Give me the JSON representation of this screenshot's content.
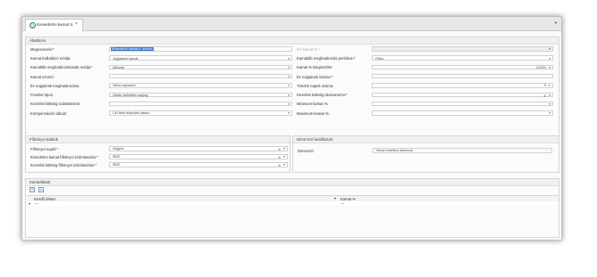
{
  "tab": {
    "title": "Kiesedelmi kamat tr.",
    "close": "×",
    "menu": "▾",
    "icon": "leaf-icon"
  },
  "general": {
    "title": "Általános",
    "left": [
      {
        "label": "Megnevezés:*",
        "value": "Késedelmi kamat tr. szerint",
        "highlight": true
      },
      {
        "label": "Kamat kalkuláció módja:",
        "value": "Jegybanki kamat",
        "ctrl": "dd"
      },
      {
        "label": "Kamatláb meghatározásának módja:*",
        "value": "Időszak",
        "ctrl": "dd"
      },
      {
        "label": "Kamat szorzó:",
        "value": "",
        "ctrl": "dd"
      },
      {
        "label": "Év napjainak meghatározása:",
        "value": "Valós napszám",
        "ctrl": "dd"
      },
      {
        "label": "Fizetési típus:",
        "value": "Utolsó befizetés napjág",
        "ctrl": "dd"
      },
      {
        "label": "Kezelési költség számlakörön:",
        "value": "",
        "ctrl": "dd"
      },
      {
        "label": "Kompenzációs dátum:",
        "value": "Cél tétel teljesítés dátum",
        "ctrl": "dd"
      }
    ],
    "right": [
      {
        "label": "Fix kamat %:*",
        "value": "",
        "ctrl": "dd",
        "disabled": true
      },
      {
        "label": "Kamatláb meghatározás periódus:*",
        "value": "Félév",
        "ctrl": "dd"
      },
      {
        "label": "Kamat % kiegészítés:",
        "value": "5,00%",
        "ctrl": "dd",
        "right": true
      },
      {
        "label": "Év napjainak száma:*",
        "value": "",
        "ctrl": "none"
      },
      {
        "label": "Türelmi napok száma:",
        "value": "5",
        "ctrl": "spin",
        "right": true
      },
      {
        "label": "Kezelési költség devizanemo:*",
        "value": "",
        "ctrl": "clear-dd"
      },
      {
        "label": "Minimum kamat %:",
        "value": "",
        "ctrl": "dd"
      },
      {
        "label": "Maximum kamat %:",
        "value": "",
        "ctrl": "dd"
      }
    ]
  },
  "ledger": {
    "title": "Főkönyvi adatok",
    "rows": [
      {
        "label": "Főkönyvi napló:*",
        "value": "Vegyes",
        "ctrl": "clear-dd"
      },
      {
        "label": "Késedelmi kamat főkönyvi számlaszám:*",
        "value": "9632",
        "ctrl": "clear-dd"
      },
      {
        "label": "Kezelési költség főkönyvi számlaszám:*",
        "value": "9632",
        "ctrl": "clear-dd"
      }
    ]
  },
  "dimension": {
    "title": "Dimenzió beállítások",
    "label": "Dimenzió:",
    "value": "Nincs beállítva dimenzió",
    "button": "···"
  },
  "rates": {
    "title": "Kamatlábak",
    "toolbar": [
      {
        "name": "add-row-icon",
        "glyph": "+"
      },
      {
        "name": "delete-row-icon",
        "glyph": "▪"
      }
    ],
    "columns": [
      "Kezdő dátum",
      "Kamat %"
    ],
    "row": [
      "---",
      "---"
    ],
    "row_marker": "▾"
  }
}
